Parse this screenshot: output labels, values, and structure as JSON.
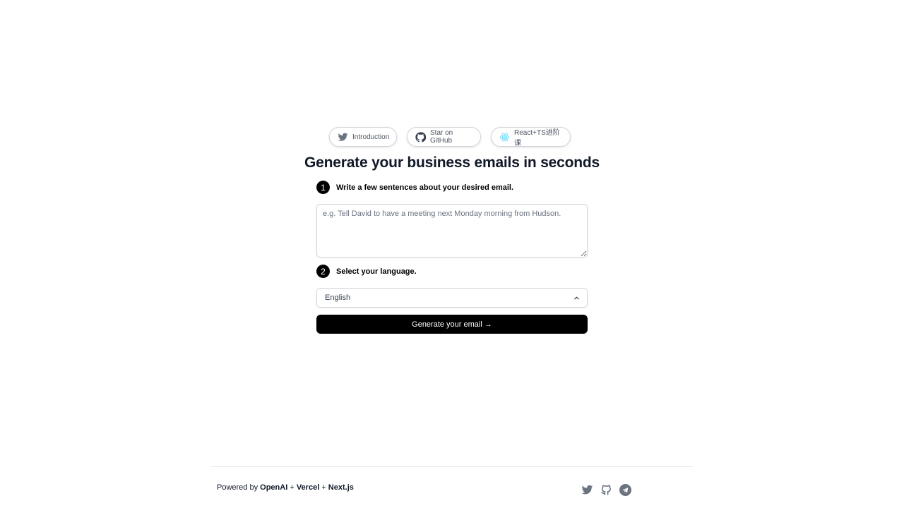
{
  "header": {
    "pills": [
      {
        "label": "Introduction",
        "icon": "twitter-icon"
      },
      {
        "label": "Star on GitHub",
        "icon": "github-icon"
      },
      {
        "label": "React+TS进阶课",
        "icon": "react-icon"
      }
    ],
    "title": "Generate your business emails in seconds"
  },
  "form": {
    "step1": {
      "number": "1",
      "label": "Write a few sentences about your desired email."
    },
    "textarea": {
      "value": "",
      "placeholder": "e.g. Tell David to have a meeting next Monday morning from Hudson."
    },
    "step2": {
      "number": "2",
      "label": "Select your language."
    },
    "language": {
      "selected": "English",
      "icon": "chevron-up-icon"
    },
    "submit_label": "Generate your email →"
  },
  "footer": {
    "powered_prefix": "Powered by ",
    "openai": "OpenAI",
    "sep1": " + ",
    "vercel": "Vercel",
    "sep2": " + ",
    "nextjs": "Next.js",
    "social": [
      "twitter-icon",
      "github-icon",
      "telegram-icon"
    ]
  },
  "colors": {
    "accent": "#000000",
    "react_icon": "#61dafb",
    "icon_gray": "#6b7280"
  }
}
